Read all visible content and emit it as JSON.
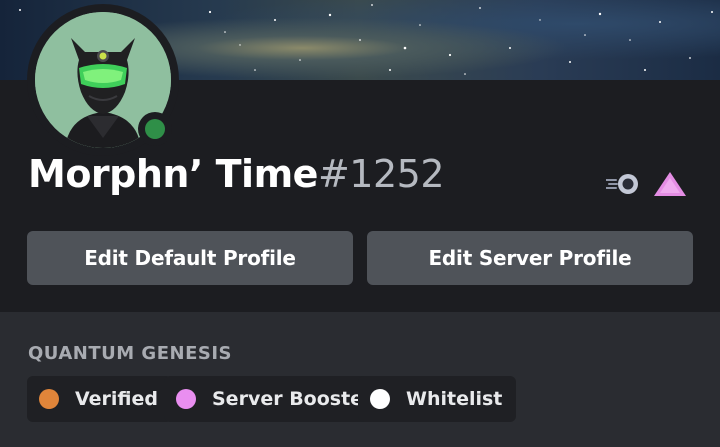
{
  "profile": {
    "username": "Morphn’ Time",
    "discriminator": "#1252",
    "status": "online"
  },
  "badges": [
    {
      "icon": "nitro-boost-icon",
      "color": "#b9bfd0"
    },
    {
      "icon": "server-booster-icon",
      "color": "#e48de4"
    }
  ],
  "actions": {
    "edit_default": "Edit Default Profile",
    "edit_server": "Edit Server Profile"
  },
  "server": {
    "name": "QUANTUM GENESIS",
    "roles": [
      {
        "label": "Verified",
        "color": "#e0853a"
      },
      {
        "label": "Server Booster",
        "color": "#e98ef0"
      },
      {
        "label": "Whitelist",
        "color": "#ffffff"
      }
    ]
  },
  "colors": {
    "status_online": "#2f8f48",
    "button_bg": "#4f5359"
  }
}
